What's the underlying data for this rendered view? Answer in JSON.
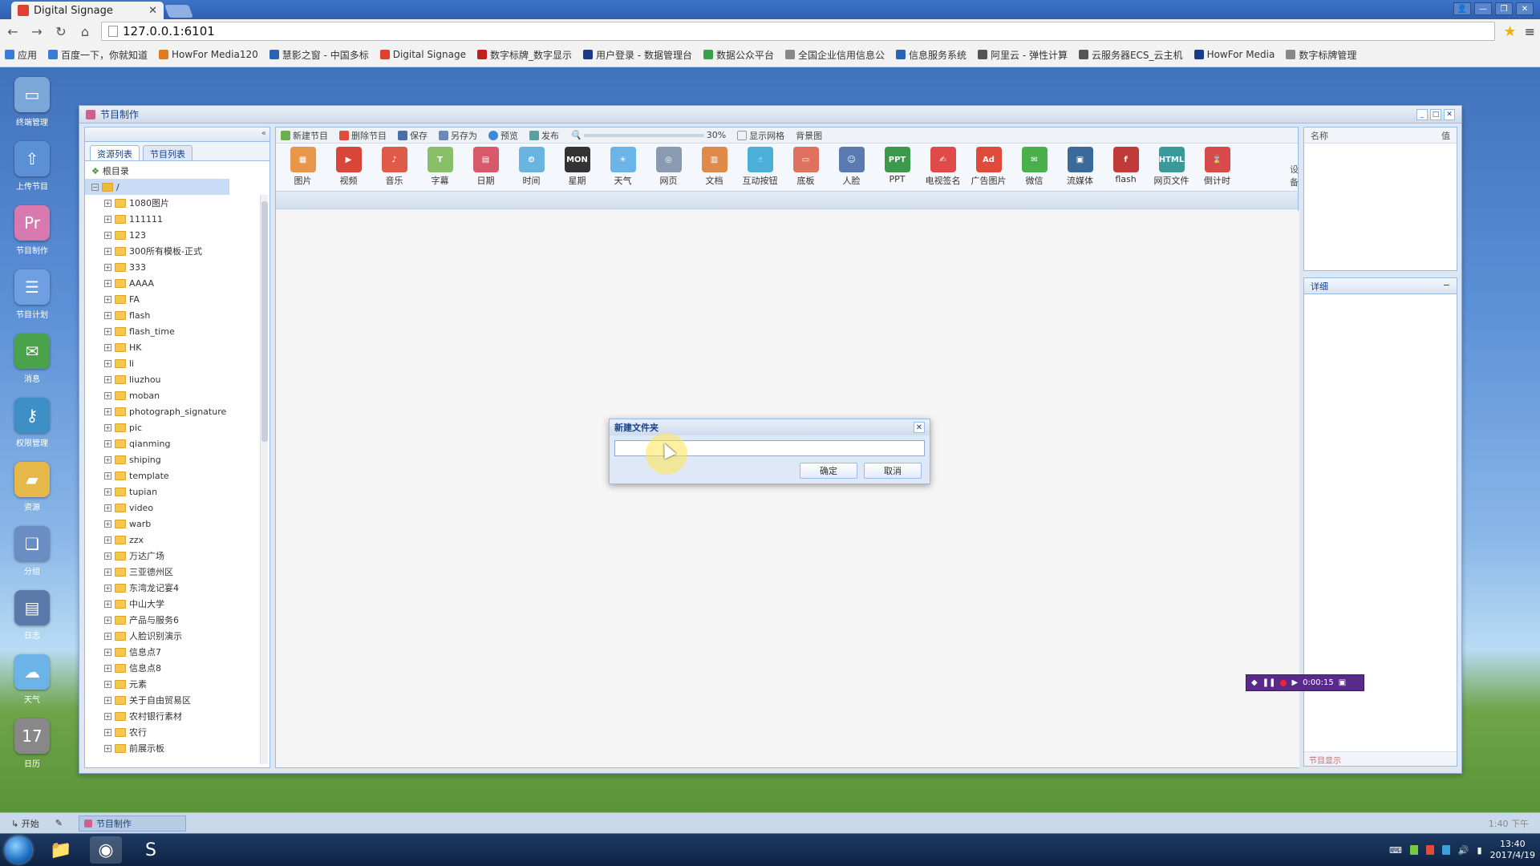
{
  "browser": {
    "tab_title": "Digital Signage",
    "url": "127.0.0.1:6101",
    "bookmarks": [
      "应用",
      "百度一下，你就知道",
      "HowFor Media120",
      "慧影之窗 - 中国多标",
      "Digital Signage",
      "数字标牌_数字显示",
      "用户登录 - 数据管理台",
      "数据公众平台",
      "全国企业信用信息公",
      "信息服务系统",
      "阿里云 - 弹性计算",
      "云服务器ECS_云主机",
      "HowFor Media",
      "数字标牌管理"
    ]
  },
  "dock": [
    {
      "label": "终端管理",
      "icon": "monitor-icon",
      "color": "#7aa7d8"
    },
    {
      "label": "上传节目",
      "icon": "upload-icon",
      "color": "#5b8fd6"
    },
    {
      "label": "节目制作",
      "icon": "pr-icon",
      "color": "#d87ab0"
    },
    {
      "label": "节目计划",
      "icon": "list-icon",
      "color": "#6e9fe0"
    },
    {
      "label": "消息",
      "icon": "message-icon",
      "color": "#4aa34a"
    },
    {
      "label": "权限管理",
      "icon": "key-icon",
      "color": "#3f8fc7"
    },
    {
      "label": "资源",
      "icon": "folder-icon",
      "color": "#e6b84a"
    },
    {
      "label": "分组",
      "icon": "group-icon",
      "color": "#6a8ec4"
    },
    {
      "label": "日志",
      "icon": "log-icon",
      "color": "#5a78a8"
    },
    {
      "label": "天气",
      "icon": "weather-icon",
      "color": "#6cb4e8"
    },
    {
      "label": "日历",
      "icon": "calendar-icon",
      "color": "#888888"
    }
  ],
  "app": {
    "title": "节目制作",
    "left_tabs": [
      "资源列表",
      "节目列表"
    ],
    "tree_root": "根目录",
    "tree_nodes": [
      "1080图片",
      "111111",
      "123",
      "300所有模板-正式",
      "333",
      "AAAA",
      "FA",
      "flash",
      "flash_time",
      "HK",
      "li",
      "liuzhou",
      "moban",
      "photograph_signature",
      "pic",
      "qianming",
      "shiping",
      "template",
      "tupian",
      "video",
      "warb",
      "zzx",
      "万达广场",
      "三亚德州区",
      "东湾龙记宴4",
      "中山大学",
      "产品与服务6",
      "人脸识别演示",
      "信息点7",
      "信息点8",
      "元素",
      "关于自由贸易区",
      "农村银行素材",
      "农行",
      "前展示板"
    ],
    "toolbar": {
      "new_program": "新建节目",
      "delete": "删除节目",
      "save": "保存",
      "save_as": "另存为",
      "preview": "预览",
      "publish": "发布",
      "zoom": "30%",
      "show_grid": "显示网格",
      "background": "背景图"
    },
    "widgets": [
      "图片",
      "视频",
      "音乐",
      "字幕",
      "日期",
      "时间",
      "星期",
      "天气",
      "网页",
      "文档",
      "互动按钮",
      "底板",
      "人脸",
      "PPT",
      "电视签名",
      "广告图片",
      "微信",
      "流媒体",
      "flash",
      "网页文件",
      "倒计时"
    ],
    "right_panel": {
      "tab": "设备",
      "col_name": "名称",
      "col_value": "值",
      "details_title": "详细",
      "footer": "节目显示"
    },
    "side_label": "设备"
  },
  "dialog": {
    "title": "新建文件夹",
    "input_value": "",
    "ok": "确定",
    "cancel": "取消"
  },
  "recorder": {
    "time": "0:00:15"
  },
  "statusbar": {
    "start": "开始",
    "task": "节目制作",
    "time": "1:40 下午"
  },
  "taskbar": {
    "clock_time": "13:40",
    "clock_date": "2017/4/19"
  }
}
